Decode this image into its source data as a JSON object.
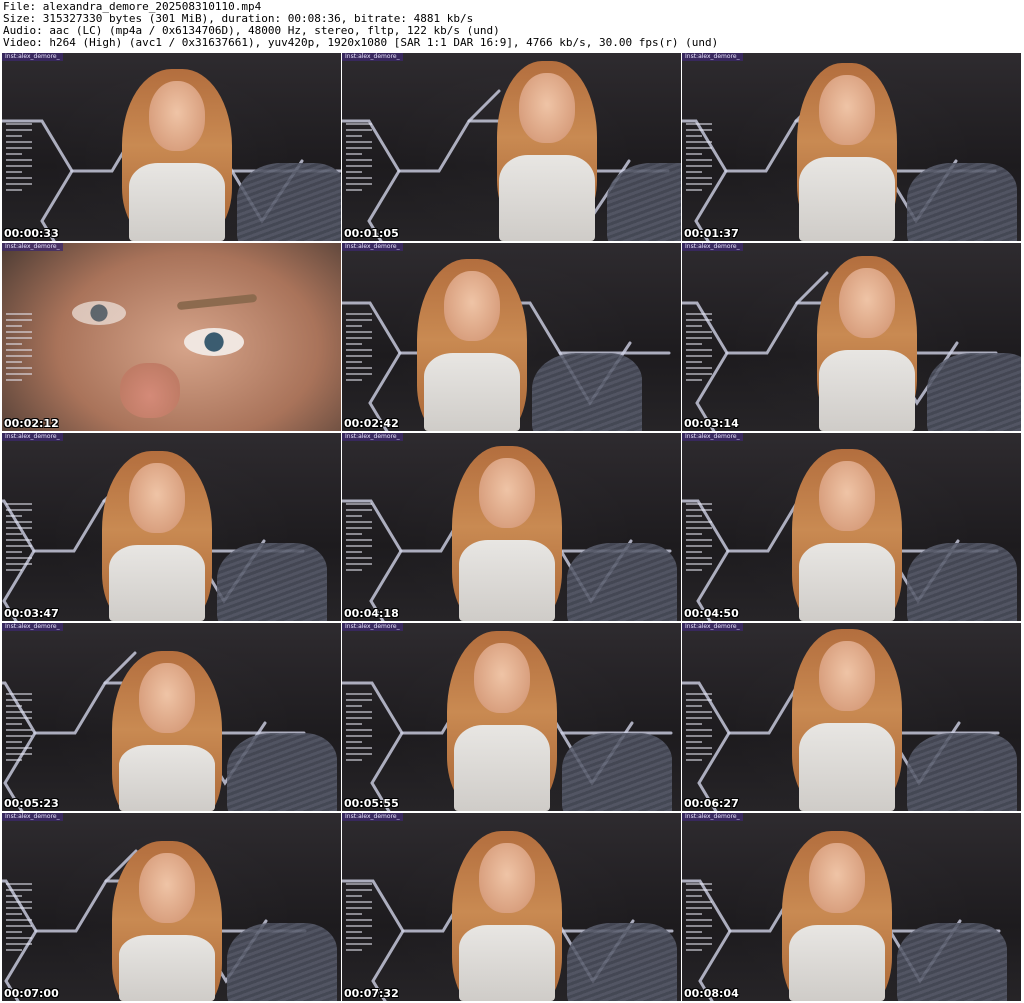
{
  "header": {
    "file_line": "File: alexandra_demore_202508310110.mp4",
    "size_line": "Size: 315327330 bytes (301 MiB), duration: 00:08:36, bitrate: 4881 kb/s",
    "audio_line": "Audio: aac (LC) (mp4a / 0x6134706D), 48000 Hz, stereo, fltp, 122 kb/s (und)",
    "video_line": "Video: h264 (High) (avc1 / 0x31637661), yuv420p, 1920x1080 [SAR 1:1 DAR 16:9], 4766 kb/s, 30.00 fps(r) (und)"
  },
  "watermark_text": "Inst:alex_demore_",
  "thumbnails": [
    {
      "timestamp": "00:00:33"
    },
    {
      "timestamp": "00:01:05"
    },
    {
      "timestamp": "00:01:37"
    },
    {
      "timestamp": "00:02:12"
    },
    {
      "timestamp": "00:02:42"
    },
    {
      "timestamp": "00:03:14"
    },
    {
      "timestamp": "00:03:47"
    },
    {
      "timestamp": "00:04:18"
    },
    {
      "timestamp": "00:04:50"
    },
    {
      "timestamp": "00:05:23"
    },
    {
      "timestamp": "00:05:55"
    },
    {
      "timestamp": "00:06:27"
    },
    {
      "timestamp": "00:07:00"
    },
    {
      "timestamp": "00:07:32"
    },
    {
      "timestamp": "00:08:04"
    }
  ],
  "colors": {
    "background": "#ffffff",
    "timestamp_text": "#ffffff",
    "watermark_bg": "#3c286e"
  }
}
